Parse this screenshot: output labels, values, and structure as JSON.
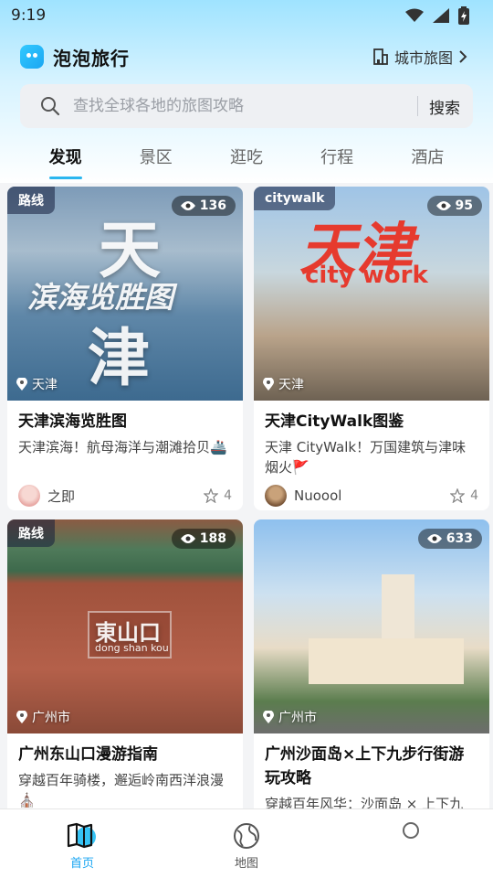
{
  "status_bar": {
    "time": "9:19"
  },
  "header": {
    "app_name": "泡泡旅行",
    "city_map_label": "城市旅图"
  },
  "search": {
    "placeholder": "查找全球各地的旅图攻略",
    "button_label": "搜索"
  },
  "tabs": [
    {
      "label": "发现",
      "active": true
    },
    {
      "label": "景区",
      "active": false
    },
    {
      "label": "逛吃",
      "active": false
    },
    {
      "label": "行程",
      "active": false
    },
    {
      "label": "酒店",
      "active": false
    }
  ],
  "cards": [
    {
      "tag": "路线",
      "views": "136",
      "location": "天津",
      "title": "天津滨海览胜图",
      "desc": "天津滨海！航母海洋与潮滩拾贝🚢",
      "author": "之即",
      "likes": "4",
      "photo_text": [
        "天",
        "滨海览胜图",
        "津"
      ]
    },
    {
      "tag": "citywalk",
      "views": "95",
      "location": "天津",
      "title": "天津CityWalk图鉴",
      "desc": "天津 CityWalk！万国建筑与津味烟火🚩",
      "author": "Nuoool",
      "likes": "4",
      "photo_text": [
        "天津",
        "city work"
      ]
    },
    {
      "tag": "路线",
      "views": "188",
      "location": "广州市",
      "title": "广州东山口漫游指南",
      "desc": "穿越百年骑楼，邂逅岭南西洋浪漫⛪",
      "author": "",
      "likes": "",
      "photo_text": [
        "東山口",
        "dong shan kou"
      ]
    },
    {
      "tag": "",
      "views": "633",
      "location": "广州市",
      "title": "广州沙面岛×上下九步行街游玩攻略",
      "desc": "穿越百年风华：沙面岛 × 上下九",
      "author": "",
      "likes": "",
      "photo_text": []
    }
  ],
  "bottom_nav": [
    {
      "label": "首页",
      "icon": "map-home-icon",
      "active": true
    },
    {
      "label": "地图",
      "icon": "globe-icon",
      "active": false
    },
    {
      "label": "",
      "icon": "circle-icon",
      "active": false
    }
  ],
  "colors": {
    "accent": "#1aa6f2",
    "tab_underline": "#2ab6ef"
  }
}
